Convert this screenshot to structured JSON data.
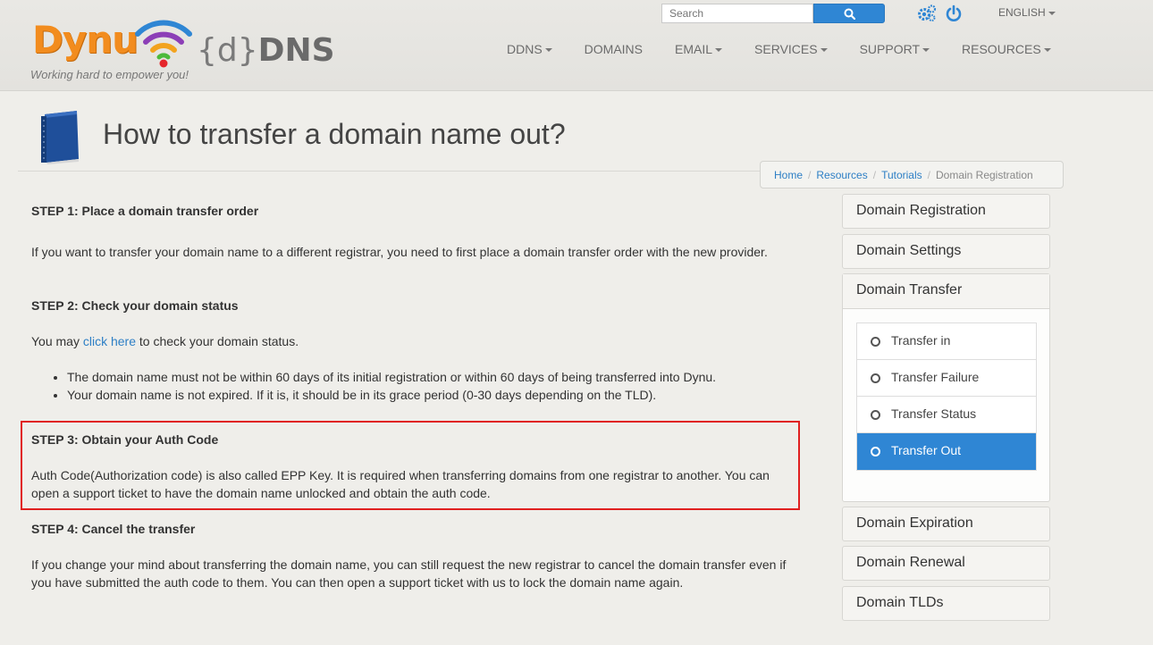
{
  "header": {
    "logo": {
      "brand": "Dynu",
      "product_prefix": "{d}",
      "product": "DNS",
      "tagline": "Working hard to empower you!"
    },
    "search": {
      "placeholder": "Search"
    },
    "language": "ENGLISH",
    "nav": [
      "DDNS",
      "DOMAINS",
      "EMAIL",
      "SERVICES",
      "SUPPORT",
      "RESOURCES"
    ],
    "nav_dropdowns": [
      true,
      false,
      true,
      true,
      true,
      true
    ]
  },
  "page": {
    "title": "How to transfer a domain name out?",
    "breadcrumb": [
      "Home",
      "Resources",
      "Tutorials",
      "Domain Registration"
    ]
  },
  "content": {
    "step1_title": "STEP 1: Place a domain transfer order",
    "step1_text": "If you want to transfer your domain name to a different registrar, you need to first place a domain transfer order with the new provider.",
    "step2_title": "STEP 2: Check your domain status",
    "step2_text_before": "You may ",
    "step2_link": "click here",
    "step2_text_after": " to check your domain status.",
    "step2_bullets": [
      "The domain name must not be within 60 days of its initial registration or within 60 days of being transferred into Dynu.",
      "Your domain name is not expired. If it is, it should be in its grace period (0-30 days depending on the TLD)."
    ],
    "step3_title": "STEP 3: Obtain your Auth Code",
    "step3_text": "Auth Code(Authorization code) is also called EPP Key. It is required when transferring domains from one registrar to another. You can open a support ticket to have the domain name unlocked and obtain the auth code.",
    "step4_title": "STEP 4: Cancel the transfer",
    "step4_text": "If you change your mind about transferring the domain name, you can still request the new registrar to cancel the domain transfer even if you have submitted the auth code to them. You can then open a support ticket with us to lock the domain name again."
  },
  "sidebar": {
    "items_top": [
      "Domain Registration",
      "Domain Settings"
    ],
    "expanded": {
      "title": "Domain Transfer",
      "sub_items": [
        "Transfer in",
        "Transfer Failure",
        "Transfer Status",
        "Transfer Out"
      ],
      "active": "Transfer Out"
    },
    "items_bottom": [
      "Domain Expiration",
      "Domain Renewal",
      "Domain TLDs"
    ]
  },
  "colors": {
    "accent": "#2f86d4",
    "highlight_border": "#e02020",
    "link": "#2d7fc5",
    "logo_orange": "#f28c1e"
  }
}
